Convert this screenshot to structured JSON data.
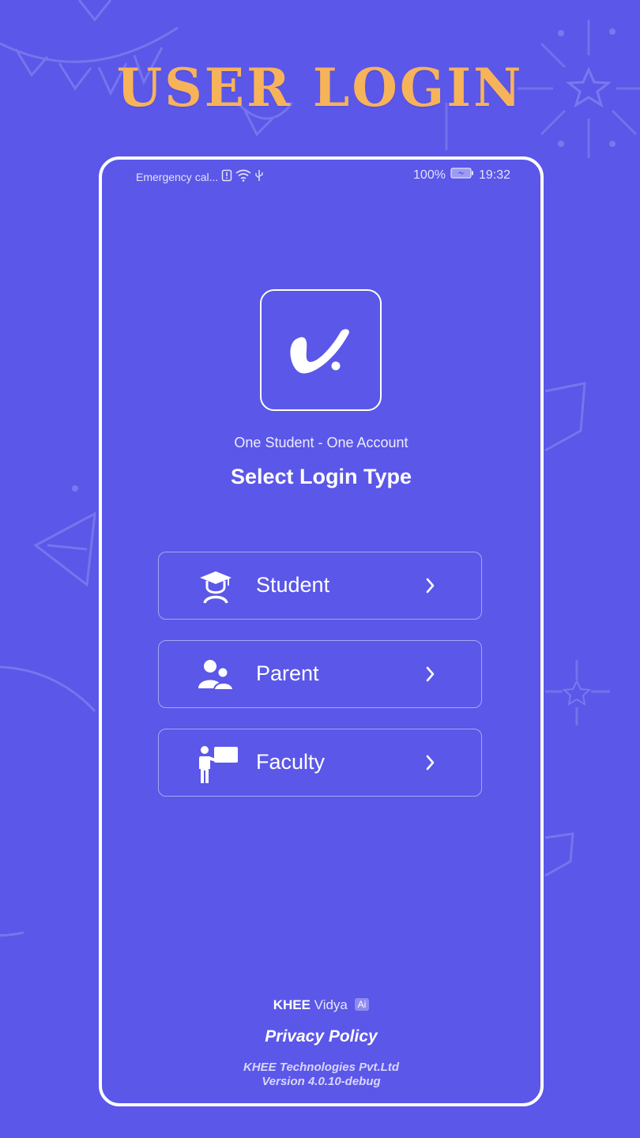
{
  "promo": {
    "title": "USER LOGIN"
  },
  "status_bar": {
    "carrier_text": "Emergency cal...",
    "battery_text": "100%",
    "time": "19:32",
    "icons": [
      "alert-icon",
      "wifi-icon",
      "usb-icon",
      "battery-icon"
    ]
  },
  "app": {
    "logo_icon": "khee-v-logo",
    "tagline": "One Student - One Account",
    "heading": "Select Login Type"
  },
  "login_options": [
    {
      "label": "Student",
      "icon": "student-graduation-cap-icon"
    },
    {
      "label": "Parent",
      "icon": "parent-users-icon"
    },
    {
      "label": "Faculty",
      "icon": "faculty-teacher-board-icon"
    }
  ],
  "footer": {
    "brand_strong": "KHEE",
    "brand_light": "Vidya",
    "brand_badge": "Ai",
    "privacy_label": "Privacy Policy",
    "company": "KHEE Technologies Pvt.Ltd",
    "version": "Version 4.0.10-debug"
  },
  "colors": {
    "background": "#5b57e8",
    "accent_title": "#f7b35a",
    "text": "#ffffff"
  }
}
